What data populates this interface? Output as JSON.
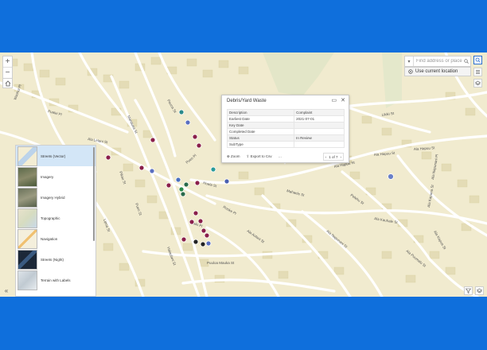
{
  "map": {
    "zoom_in": "+",
    "zoom_out": "−",
    "search": {
      "placeholder": "Find address or place"
    },
    "use_location": "Use current location",
    "street_labels": [
      "Likiki St",
      "Ala Hapuu St",
      "Ala Hapuu St",
      "Ala Hapuu St",
      "Ala Kauhale St",
      "Ala Aolani St",
      "Ala Napunani St",
      "Pualei Pl",
      "Ala Lelani St",
      "Waohui Pl",
      "Manauea St",
      "Pauoa St",
      "Ala Kapuna St",
      "Hoala St",
      "Pueo St",
      "Rooke Pl",
      "Puuloa Mauka St",
      "Halaulani St",
      "Mahaele St",
      "Pelehu St",
      "Ala Puumalu St",
      "Ala Kapua St",
      "Ala Napunani Pl",
      "Lipoa St",
      "Pikau St",
      "Laiki Pl",
      "Pueo Pl"
    ]
  },
  "popup": {
    "title": "Debris/Yard Waste",
    "rows": [
      {
        "label": "Description",
        "value": "Complaint"
      },
      {
        "label": "Earliest Date",
        "value": "2021-07-01"
      },
      {
        "label": "Key Date",
        "value": ""
      },
      {
        "label": "Completed Date",
        "value": ""
      },
      {
        "label": "Status",
        "value": "In Review"
      },
      {
        "label": "SubType",
        "value": ""
      }
    ],
    "zoom_to": "Zoom",
    "export": "Export to Csv",
    "more": "···",
    "page": "1 of 7"
  },
  "basemaps": [
    {
      "label": "Streets (Vector)",
      "selected": true
    },
    {
      "label": "Imagery"
    },
    {
      "label": "Imagery Hybrid"
    },
    {
      "label": "Topographic"
    },
    {
      "label": "Navigation"
    },
    {
      "label": "Streets (Night)"
    },
    {
      "label": "Terrain with Labels"
    }
  ]
}
